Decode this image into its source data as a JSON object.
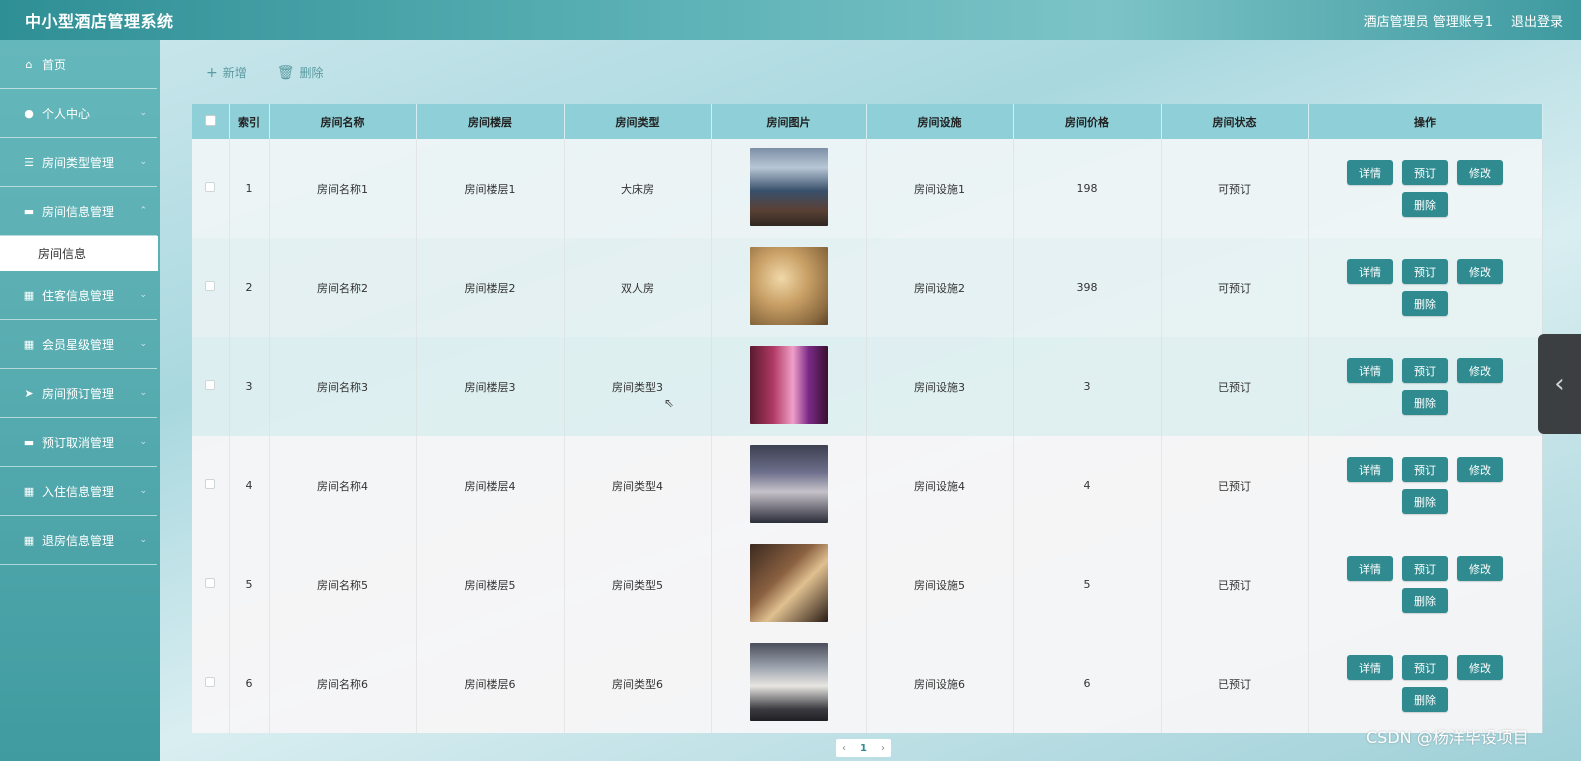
{
  "header": {
    "title": "中小型酒店管理系统",
    "user_label": "酒店管理员 管理账号1",
    "logout": "退出登录"
  },
  "sidebar": {
    "items": [
      {
        "label": "首页",
        "icon": "home-icon",
        "glyph": "⌂"
      },
      {
        "label": "个人中心",
        "icon": "user-icon",
        "glyph": "●"
      },
      {
        "label": "房间类型管理",
        "icon": "sliders-icon",
        "glyph": "☰"
      },
      {
        "label": "房间信息管理",
        "icon": "monitor-icon",
        "glyph": "▬"
      },
      {
        "label": "住客信息管理",
        "icon": "grid-icon",
        "glyph": "▦"
      },
      {
        "label": "会员星级管理",
        "icon": "grid-icon",
        "glyph": "▦"
      },
      {
        "label": "房间预订管理",
        "icon": "send-icon",
        "glyph": "➤"
      },
      {
        "label": "预订取消管理",
        "icon": "ticket-icon",
        "glyph": "▬"
      },
      {
        "label": "入住信息管理",
        "icon": "grid-icon",
        "glyph": "▦"
      },
      {
        "label": "退房信息管理",
        "icon": "grid-icon",
        "glyph": "▦"
      }
    ],
    "active_sub": "房间信息"
  },
  "toolbar": {
    "add": "新增",
    "delete": "删除"
  },
  "table": {
    "columns": [
      "索引",
      "房间名称",
      "房间楼层",
      "房间类型",
      "房间图片",
      "房间设施",
      "房间价格",
      "房间状态",
      "操作"
    ],
    "rows": [
      {
        "index": "1",
        "name": "房间名称1",
        "floor": "房间楼层1",
        "type": "大床房",
        "facility": "房间设施1",
        "price": "198",
        "status": "可预订"
      },
      {
        "index": "2",
        "name": "房间名称2",
        "floor": "房间楼层2",
        "type": "双人房",
        "facility": "房间设施2",
        "price": "398",
        "status": "可预订"
      },
      {
        "index": "3",
        "name": "房间名称3",
        "floor": "房间楼层3",
        "type": "房间类型3",
        "facility": "房间设施3",
        "price": "3",
        "status": "已预订"
      },
      {
        "index": "4",
        "name": "房间名称4",
        "floor": "房间楼层4",
        "type": "房间类型4",
        "facility": "房间设施4",
        "price": "4",
        "status": "已预订"
      },
      {
        "index": "5",
        "name": "房间名称5",
        "floor": "房间楼层5",
        "type": "房间类型5",
        "facility": "房间设施5",
        "price": "5",
        "status": "已预订"
      },
      {
        "index": "6",
        "name": "房间名称6",
        "floor": "房间楼层6",
        "type": "房间类型6",
        "facility": "房间设施6",
        "price": "6",
        "status": "已预订"
      }
    ],
    "actions": {
      "detail": "详情",
      "book": "预订",
      "edit": "修改",
      "delete": "删除"
    }
  },
  "pagination": {
    "prev": "‹",
    "current": "1",
    "next": "›"
  },
  "watermark": "CSDN @杨洋毕设项目",
  "colors": {
    "accent": "#2f8b90",
    "header_bg": "#8fd0d8",
    "sidebar_bg": "#5aaeb2"
  }
}
